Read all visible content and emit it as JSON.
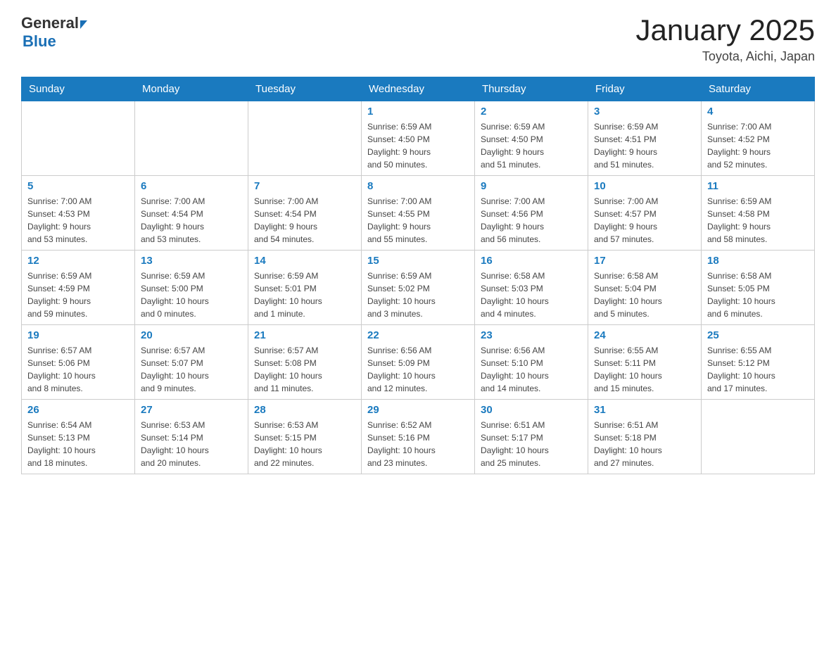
{
  "header": {
    "logo": {
      "general": "General",
      "blue": "Blue"
    },
    "title": "January 2025",
    "subtitle": "Toyota, Aichi, Japan"
  },
  "calendar": {
    "days": [
      "Sunday",
      "Monday",
      "Tuesday",
      "Wednesday",
      "Thursday",
      "Friday",
      "Saturday"
    ],
    "weeks": [
      [
        {
          "day": "",
          "info": ""
        },
        {
          "day": "",
          "info": ""
        },
        {
          "day": "",
          "info": ""
        },
        {
          "day": "1",
          "info": "Sunrise: 6:59 AM\nSunset: 4:50 PM\nDaylight: 9 hours\nand 50 minutes."
        },
        {
          "day": "2",
          "info": "Sunrise: 6:59 AM\nSunset: 4:50 PM\nDaylight: 9 hours\nand 51 minutes."
        },
        {
          "day": "3",
          "info": "Sunrise: 6:59 AM\nSunset: 4:51 PM\nDaylight: 9 hours\nand 51 minutes."
        },
        {
          "day": "4",
          "info": "Sunrise: 7:00 AM\nSunset: 4:52 PM\nDaylight: 9 hours\nand 52 minutes."
        }
      ],
      [
        {
          "day": "5",
          "info": "Sunrise: 7:00 AM\nSunset: 4:53 PM\nDaylight: 9 hours\nand 53 minutes."
        },
        {
          "day": "6",
          "info": "Sunrise: 7:00 AM\nSunset: 4:54 PM\nDaylight: 9 hours\nand 53 minutes."
        },
        {
          "day": "7",
          "info": "Sunrise: 7:00 AM\nSunset: 4:54 PM\nDaylight: 9 hours\nand 54 minutes."
        },
        {
          "day": "8",
          "info": "Sunrise: 7:00 AM\nSunset: 4:55 PM\nDaylight: 9 hours\nand 55 minutes."
        },
        {
          "day": "9",
          "info": "Sunrise: 7:00 AM\nSunset: 4:56 PM\nDaylight: 9 hours\nand 56 minutes."
        },
        {
          "day": "10",
          "info": "Sunrise: 7:00 AM\nSunset: 4:57 PM\nDaylight: 9 hours\nand 57 minutes."
        },
        {
          "day": "11",
          "info": "Sunrise: 6:59 AM\nSunset: 4:58 PM\nDaylight: 9 hours\nand 58 minutes."
        }
      ],
      [
        {
          "day": "12",
          "info": "Sunrise: 6:59 AM\nSunset: 4:59 PM\nDaylight: 9 hours\nand 59 minutes."
        },
        {
          "day": "13",
          "info": "Sunrise: 6:59 AM\nSunset: 5:00 PM\nDaylight: 10 hours\nand 0 minutes."
        },
        {
          "day": "14",
          "info": "Sunrise: 6:59 AM\nSunset: 5:01 PM\nDaylight: 10 hours\nand 1 minute."
        },
        {
          "day": "15",
          "info": "Sunrise: 6:59 AM\nSunset: 5:02 PM\nDaylight: 10 hours\nand 3 minutes."
        },
        {
          "day": "16",
          "info": "Sunrise: 6:58 AM\nSunset: 5:03 PM\nDaylight: 10 hours\nand 4 minutes."
        },
        {
          "day": "17",
          "info": "Sunrise: 6:58 AM\nSunset: 5:04 PM\nDaylight: 10 hours\nand 5 minutes."
        },
        {
          "day": "18",
          "info": "Sunrise: 6:58 AM\nSunset: 5:05 PM\nDaylight: 10 hours\nand 6 minutes."
        }
      ],
      [
        {
          "day": "19",
          "info": "Sunrise: 6:57 AM\nSunset: 5:06 PM\nDaylight: 10 hours\nand 8 minutes."
        },
        {
          "day": "20",
          "info": "Sunrise: 6:57 AM\nSunset: 5:07 PM\nDaylight: 10 hours\nand 9 minutes."
        },
        {
          "day": "21",
          "info": "Sunrise: 6:57 AM\nSunset: 5:08 PM\nDaylight: 10 hours\nand 11 minutes."
        },
        {
          "day": "22",
          "info": "Sunrise: 6:56 AM\nSunset: 5:09 PM\nDaylight: 10 hours\nand 12 minutes."
        },
        {
          "day": "23",
          "info": "Sunrise: 6:56 AM\nSunset: 5:10 PM\nDaylight: 10 hours\nand 14 minutes."
        },
        {
          "day": "24",
          "info": "Sunrise: 6:55 AM\nSunset: 5:11 PM\nDaylight: 10 hours\nand 15 minutes."
        },
        {
          "day": "25",
          "info": "Sunrise: 6:55 AM\nSunset: 5:12 PM\nDaylight: 10 hours\nand 17 minutes."
        }
      ],
      [
        {
          "day": "26",
          "info": "Sunrise: 6:54 AM\nSunset: 5:13 PM\nDaylight: 10 hours\nand 18 minutes."
        },
        {
          "day": "27",
          "info": "Sunrise: 6:53 AM\nSunset: 5:14 PM\nDaylight: 10 hours\nand 20 minutes."
        },
        {
          "day": "28",
          "info": "Sunrise: 6:53 AM\nSunset: 5:15 PM\nDaylight: 10 hours\nand 22 minutes."
        },
        {
          "day": "29",
          "info": "Sunrise: 6:52 AM\nSunset: 5:16 PM\nDaylight: 10 hours\nand 23 minutes."
        },
        {
          "day": "30",
          "info": "Sunrise: 6:51 AM\nSunset: 5:17 PM\nDaylight: 10 hours\nand 25 minutes."
        },
        {
          "day": "31",
          "info": "Sunrise: 6:51 AM\nSunset: 5:18 PM\nDaylight: 10 hours\nand 27 minutes."
        },
        {
          "day": "",
          "info": ""
        }
      ]
    ]
  }
}
